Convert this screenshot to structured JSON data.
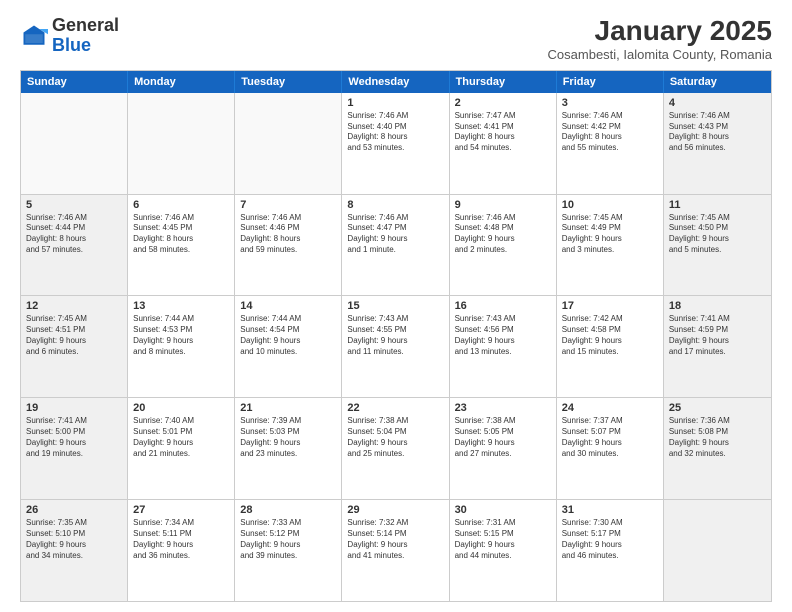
{
  "header": {
    "logo_general": "General",
    "logo_blue": "Blue",
    "month_title": "January 2025",
    "subtitle": "Cosambesti, Ialomita County, Romania"
  },
  "weekdays": [
    "Sunday",
    "Monday",
    "Tuesday",
    "Wednesday",
    "Thursday",
    "Friday",
    "Saturday"
  ],
  "rows": [
    [
      {
        "day": "",
        "text": "",
        "empty": true
      },
      {
        "day": "",
        "text": "",
        "empty": true
      },
      {
        "day": "",
        "text": "",
        "empty": true
      },
      {
        "day": "1",
        "text": "Sunrise: 7:46 AM\nSunset: 4:40 PM\nDaylight: 8 hours\nand 53 minutes.",
        "empty": false
      },
      {
        "day": "2",
        "text": "Sunrise: 7:47 AM\nSunset: 4:41 PM\nDaylight: 8 hours\nand 54 minutes.",
        "empty": false
      },
      {
        "day": "3",
        "text": "Sunrise: 7:46 AM\nSunset: 4:42 PM\nDaylight: 8 hours\nand 55 minutes.",
        "empty": false
      },
      {
        "day": "4",
        "text": "Sunrise: 7:46 AM\nSunset: 4:43 PM\nDaylight: 8 hours\nand 56 minutes.",
        "empty": false,
        "shaded": true
      }
    ],
    [
      {
        "day": "5",
        "text": "Sunrise: 7:46 AM\nSunset: 4:44 PM\nDaylight: 8 hours\nand 57 minutes.",
        "empty": false,
        "shaded": true
      },
      {
        "day": "6",
        "text": "Sunrise: 7:46 AM\nSunset: 4:45 PM\nDaylight: 8 hours\nand 58 minutes.",
        "empty": false
      },
      {
        "day": "7",
        "text": "Sunrise: 7:46 AM\nSunset: 4:46 PM\nDaylight: 8 hours\nand 59 minutes.",
        "empty": false
      },
      {
        "day": "8",
        "text": "Sunrise: 7:46 AM\nSunset: 4:47 PM\nDaylight: 9 hours\nand 1 minute.",
        "empty": false
      },
      {
        "day": "9",
        "text": "Sunrise: 7:46 AM\nSunset: 4:48 PM\nDaylight: 9 hours\nand 2 minutes.",
        "empty": false
      },
      {
        "day": "10",
        "text": "Sunrise: 7:45 AM\nSunset: 4:49 PM\nDaylight: 9 hours\nand 3 minutes.",
        "empty": false
      },
      {
        "day": "11",
        "text": "Sunrise: 7:45 AM\nSunset: 4:50 PM\nDaylight: 9 hours\nand 5 minutes.",
        "empty": false,
        "shaded": true
      }
    ],
    [
      {
        "day": "12",
        "text": "Sunrise: 7:45 AM\nSunset: 4:51 PM\nDaylight: 9 hours\nand 6 minutes.",
        "empty": false,
        "shaded": true
      },
      {
        "day": "13",
        "text": "Sunrise: 7:44 AM\nSunset: 4:53 PM\nDaylight: 9 hours\nand 8 minutes.",
        "empty": false
      },
      {
        "day": "14",
        "text": "Sunrise: 7:44 AM\nSunset: 4:54 PM\nDaylight: 9 hours\nand 10 minutes.",
        "empty": false
      },
      {
        "day": "15",
        "text": "Sunrise: 7:43 AM\nSunset: 4:55 PM\nDaylight: 9 hours\nand 11 minutes.",
        "empty": false
      },
      {
        "day": "16",
        "text": "Sunrise: 7:43 AM\nSunset: 4:56 PM\nDaylight: 9 hours\nand 13 minutes.",
        "empty": false
      },
      {
        "day": "17",
        "text": "Sunrise: 7:42 AM\nSunset: 4:58 PM\nDaylight: 9 hours\nand 15 minutes.",
        "empty": false
      },
      {
        "day": "18",
        "text": "Sunrise: 7:41 AM\nSunset: 4:59 PM\nDaylight: 9 hours\nand 17 minutes.",
        "empty": false,
        "shaded": true
      }
    ],
    [
      {
        "day": "19",
        "text": "Sunrise: 7:41 AM\nSunset: 5:00 PM\nDaylight: 9 hours\nand 19 minutes.",
        "empty": false,
        "shaded": true
      },
      {
        "day": "20",
        "text": "Sunrise: 7:40 AM\nSunset: 5:01 PM\nDaylight: 9 hours\nand 21 minutes.",
        "empty": false
      },
      {
        "day": "21",
        "text": "Sunrise: 7:39 AM\nSunset: 5:03 PM\nDaylight: 9 hours\nand 23 minutes.",
        "empty": false
      },
      {
        "day": "22",
        "text": "Sunrise: 7:38 AM\nSunset: 5:04 PM\nDaylight: 9 hours\nand 25 minutes.",
        "empty": false
      },
      {
        "day": "23",
        "text": "Sunrise: 7:38 AM\nSunset: 5:05 PM\nDaylight: 9 hours\nand 27 minutes.",
        "empty": false
      },
      {
        "day": "24",
        "text": "Sunrise: 7:37 AM\nSunset: 5:07 PM\nDaylight: 9 hours\nand 30 minutes.",
        "empty": false
      },
      {
        "day": "25",
        "text": "Sunrise: 7:36 AM\nSunset: 5:08 PM\nDaylight: 9 hours\nand 32 minutes.",
        "empty": false,
        "shaded": true
      }
    ],
    [
      {
        "day": "26",
        "text": "Sunrise: 7:35 AM\nSunset: 5:10 PM\nDaylight: 9 hours\nand 34 minutes.",
        "empty": false,
        "shaded": true
      },
      {
        "day": "27",
        "text": "Sunrise: 7:34 AM\nSunset: 5:11 PM\nDaylight: 9 hours\nand 36 minutes.",
        "empty": false
      },
      {
        "day": "28",
        "text": "Sunrise: 7:33 AM\nSunset: 5:12 PM\nDaylight: 9 hours\nand 39 minutes.",
        "empty": false
      },
      {
        "day": "29",
        "text": "Sunrise: 7:32 AM\nSunset: 5:14 PM\nDaylight: 9 hours\nand 41 minutes.",
        "empty": false
      },
      {
        "day": "30",
        "text": "Sunrise: 7:31 AM\nSunset: 5:15 PM\nDaylight: 9 hours\nand 44 minutes.",
        "empty": false
      },
      {
        "day": "31",
        "text": "Sunrise: 7:30 AM\nSunset: 5:17 PM\nDaylight: 9 hours\nand 46 minutes.",
        "empty": false
      },
      {
        "day": "",
        "text": "",
        "empty": true,
        "shaded": true
      }
    ]
  ]
}
